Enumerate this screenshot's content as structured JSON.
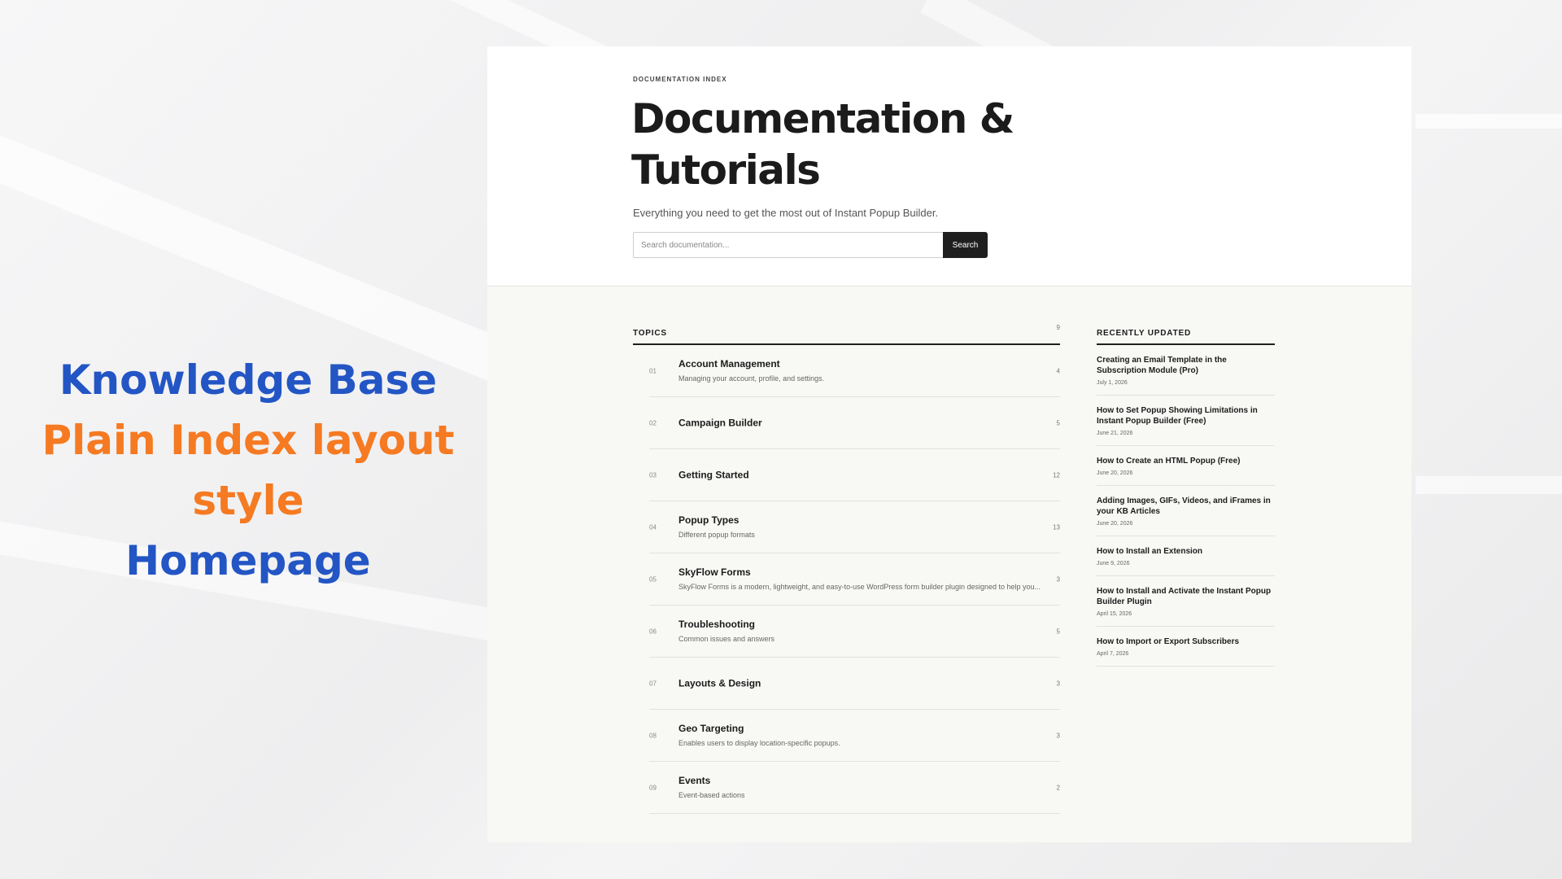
{
  "promo": {
    "line1": "Knowledge Base",
    "line2": "Plain Index layout",
    "line3": "style",
    "line4": "Homepage"
  },
  "hero": {
    "eyebrow": "DOCUMENTATION INDEX",
    "title_line1": "Documentation &",
    "title_line2": "Tutorials",
    "subtitle": "Everything you need to get the most out of Instant Popup Builder.",
    "search_placeholder": "Search documentation...",
    "search_button": "Search"
  },
  "topics": {
    "heading": "TOPICS",
    "count": "9",
    "items": [
      {
        "num": "01",
        "name": "Account Management",
        "desc": "Managing your account, profile, and settings.",
        "count": "4"
      },
      {
        "num": "02",
        "name": "Campaign Builder",
        "desc": "",
        "count": "5"
      },
      {
        "num": "03",
        "name": "Getting Started",
        "desc": "",
        "count": "12"
      },
      {
        "num": "04",
        "name": "Popup Types",
        "desc": "Different popup formats",
        "count": "13"
      },
      {
        "num": "05",
        "name": "SkyFlow Forms",
        "desc": "SkyFlow Forms is a modern, lightweight, and easy-to-use WordPress form builder plugin designed to help you...",
        "count": "3"
      },
      {
        "num": "06",
        "name": "Troubleshooting",
        "desc": "Common issues and answers",
        "count": "5"
      },
      {
        "num": "07",
        "name": "Layouts & Design",
        "desc": "",
        "count": "3"
      },
      {
        "num": "08",
        "name": "Geo Targeting",
        "desc": "Enables users to display location-specific popups.",
        "count": "3"
      },
      {
        "num": "09",
        "name": "Events",
        "desc": "Event-based actions",
        "count": "2"
      }
    ]
  },
  "recent": {
    "heading": "RECENTLY UPDATED",
    "items": [
      {
        "title": "Creating an Email Template in the Subscription Module (Pro)",
        "date": "July 1, 2026"
      },
      {
        "title": "How to Set Popup Showing Limitations in Instant Popup Builder (Free)",
        "date": "June 21, 2026"
      },
      {
        "title": "How to Create an HTML Popup (Free)",
        "date": "June 20, 2026"
      },
      {
        "title": "Adding Images, GIFs, Videos, and iFrames in your KB Articles",
        "date": "June 20, 2026"
      },
      {
        "title": "How to Install an Extension",
        "date": "June 9, 2026"
      },
      {
        "title": "How to Install and Activate the Instant Popup Builder Plugin",
        "date": "April 15, 2026"
      },
      {
        "title": "How to Import or Export Subscribers",
        "date": "April 7, 2026"
      }
    ]
  }
}
